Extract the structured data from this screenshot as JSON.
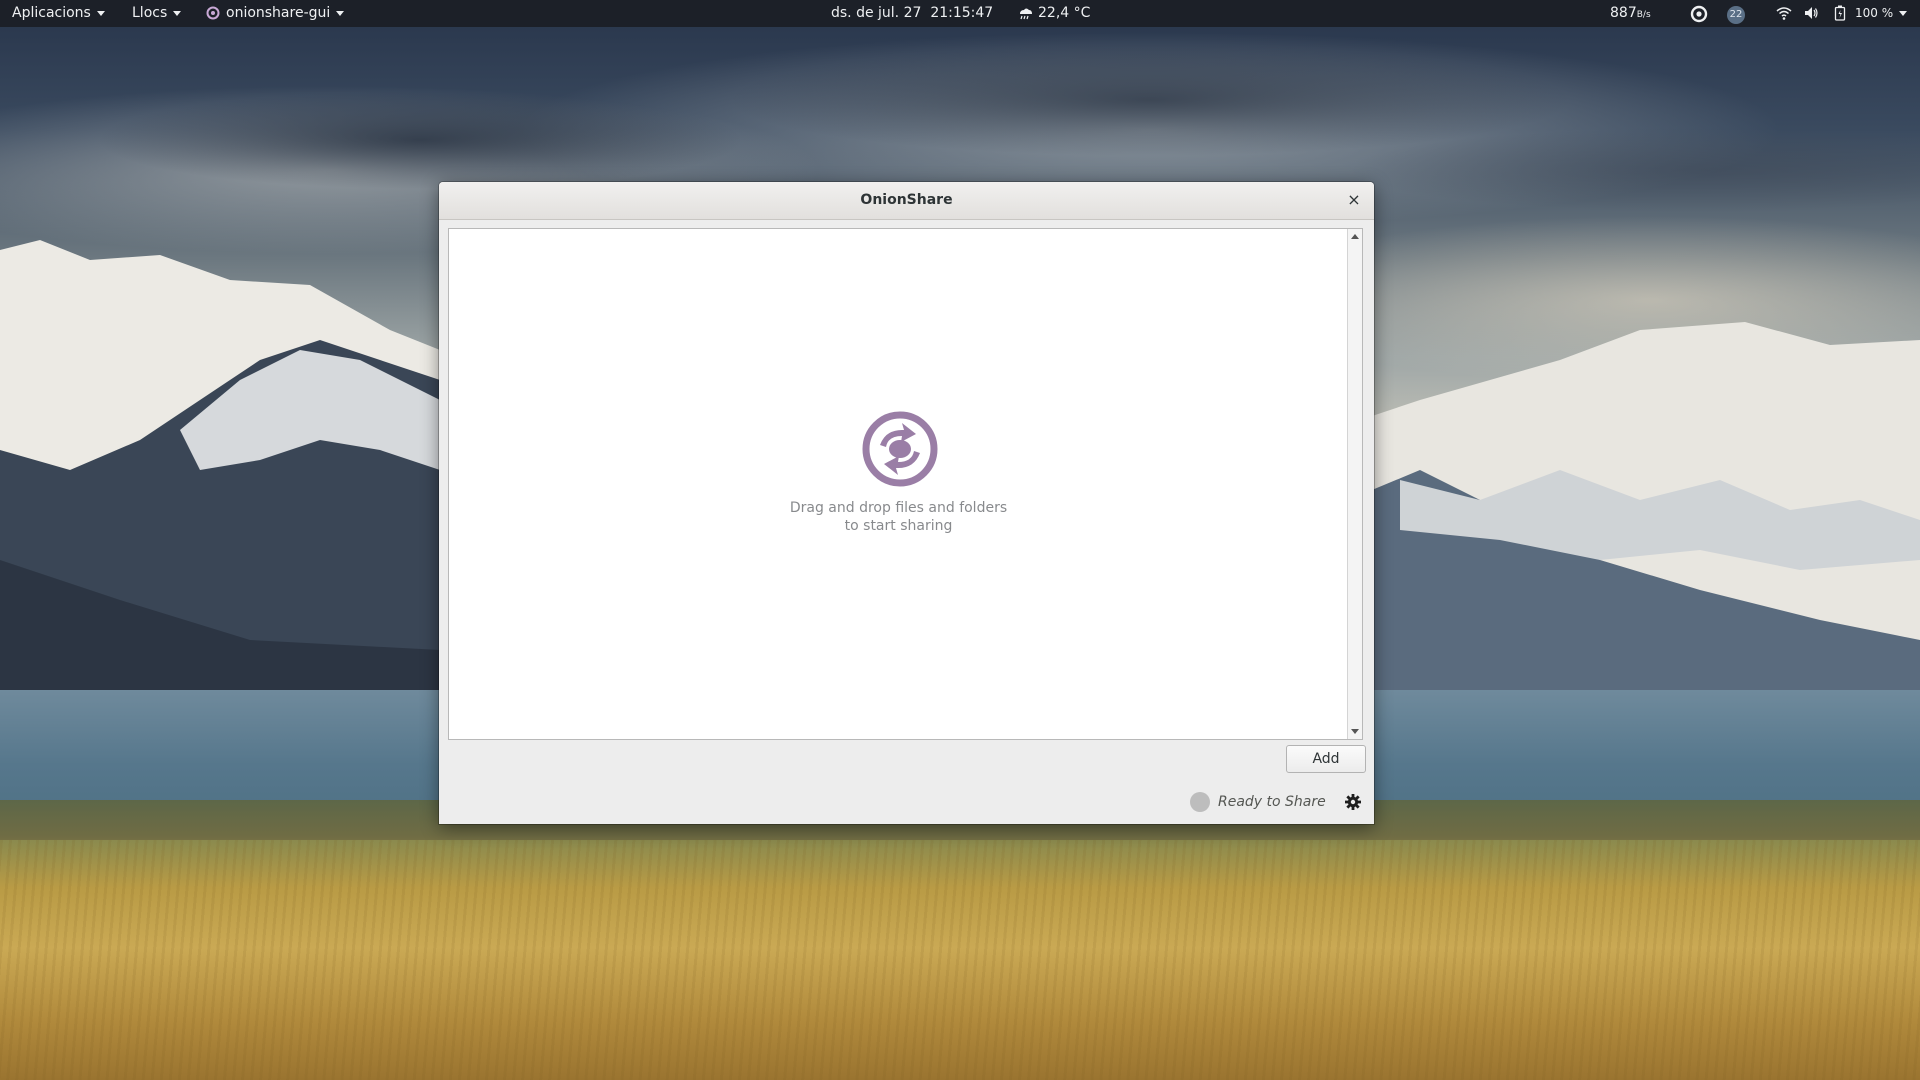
{
  "topbar": {
    "applications": "Aplicacions",
    "places": "Llocs",
    "app_menu": "onionshare-gui",
    "date": "ds. de jul. 27",
    "time": "21:15:47",
    "weather": "22,4 °C",
    "net_speed": "887",
    "net_speed_unit": "B/s",
    "notification_count": "22",
    "battery": "100 %",
    "icons": [
      "weather-icon",
      "sync-icon",
      "notification-badge",
      "wifi-icon",
      "volume-icon",
      "battery-icon"
    ]
  },
  "window": {
    "title": "OnionShare",
    "close_label": "×",
    "drop_text_line1": "Drag and drop files and folders",
    "drop_text_line2": "to start sharing",
    "add_label": "Add",
    "status": "Ready to Share",
    "logo_color": "#9a7ea6",
    "status_dot_color": "#bdbdbd"
  }
}
